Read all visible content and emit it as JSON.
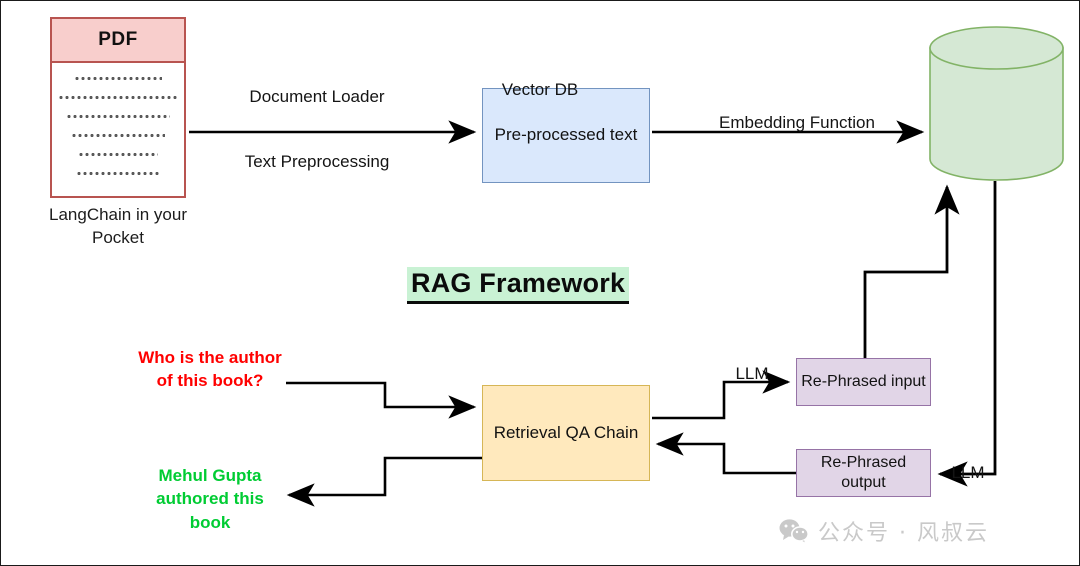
{
  "diagram": {
    "title": "RAG Framework",
    "nodes": {
      "pdf": {
        "header": "PDF",
        "caption": "LangChain in your Pocket",
        "dotted_line_widths": [
          88,
          120,
          104,
          94,
          80,
          84
        ]
      },
      "preprocessed_text": "Pre-processed text",
      "vector_db": "Vector DB",
      "retrieval_qa_chain": "Retrieval QA Chain",
      "rephrased_input": "Re-Phrased input",
      "rephrased_output": "Re-Phrased output"
    },
    "edge_labels": {
      "document_loader": "Document Loader",
      "text_preprocessing": "Text Preprocessing",
      "embedding_function": "Embedding Function",
      "llm_rephrase_input": "LLM",
      "llm_rephrase_output": "LLM"
    },
    "annotations": {
      "user_question": "Who is the author of this book?",
      "final_answer": "Mehul Gupta authored this book"
    },
    "colors": {
      "pdf_fill": "#f8cecc",
      "pdf_stroke": "#b85450",
      "blue_fill": "#dae8fc",
      "blue_stroke": "#7394c0",
      "green_fill": "#d5e8d4",
      "green_stroke": "#82b366",
      "yellow_fill": "#ffe9bd",
      "yellow_stroke": "#d6b656",
      "purple_fill": "#e1d5e7",
      "purple_stroke": "#9673a6",
      "title_highlight": "#c9f2d4",
      "question_text": "#ff0000",
      "answer_text": "#00cc33",
      "edge": "#000000"
    }
  },
  "watermark": {
    "icon": "wechat-icon",
    "text": "公众号 · 风叔云"
  }
}
